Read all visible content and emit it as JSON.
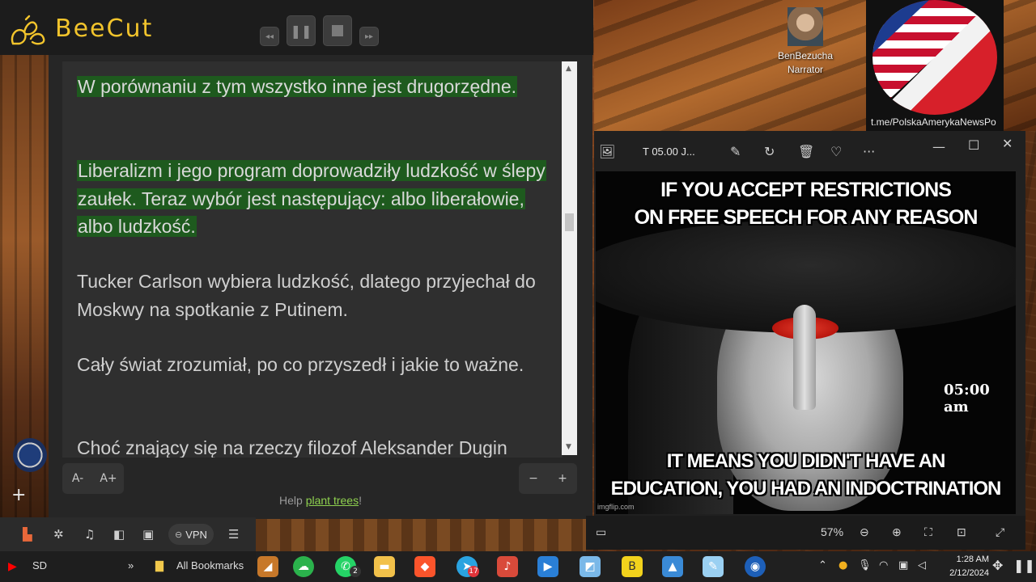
{
  "app": {
    "name": "BeeCut"
  },
  "reader": {
    "paragraphs": [
      {
        "text": "W porównaniu z tym wszystko inne jest drugorzędne.",
        "highlighted": true
      },
      {
        "text": "Liberalizm i jego program doprowadziły ludzkość w ślepy zaułek. Teraz wybór jest następujący: albo liberałowie, albo ludzkość.",
        "highlighted": true
      },
      {
        "text": "Tucker Carlson wybiera ludzkość, dlatego przyjechał do Moskwy na spotkanie z Putinem.",
        "highlighted": false
      },
      {
        "text": "Cały świat zrozumiał, po co przyszedł i jakie to ważne.",
        "highlighted": false
      },
      {
        "text": "Choć znający się na rzeczy filozof Aleksander Dugin",
        "highlighted": false
      }
    ],
    "font_smaller": "A-",
    "font_larger": "A+",
    "zoom_out": "−",
    "zoom_in": "+",
    "help_prefix": "Help ",
    "help_link": "plant trees",
    "help_suffix": "!"
  },
  "narrator": {
    "name": "BenBezucha",
    "role": "Narrator"
  },
  "flag_badge": {
    "url": "t.me/PolskaAmerykaNewsPo"
  },
  "viewer": {
    "title": "T 05.00 J...",
    "zoom": "57%",
    "meme_top_line1": "IF YOU ACCEPT RESTRICTIONS",
    "meme_top_line2": "ON FREE SPEECH FOR ANY REASON",
    "meme_bottom_line1": "IT MEANS YOU DIDN'T HAVE AN",
    "meme_bottom_line2": "EDUCATION, YOU HAD AN INDOCTRINATION",
    "time_overlay": "05:00 am",
    "watermark": "imgflip.com"
  },
  "browser": {
    "vpn_label": "VPN",
    "bookmarks": {
      "first": "SD",
      "more": "»",
      "all": "All Bookmarks"
    }
  },
  "taskbar": {
    "whatsapp_badge": "2",
    "telegram_badge": "17",
    "time": "1:28 AM",
    "date": "2/12/2024"
  }
}
